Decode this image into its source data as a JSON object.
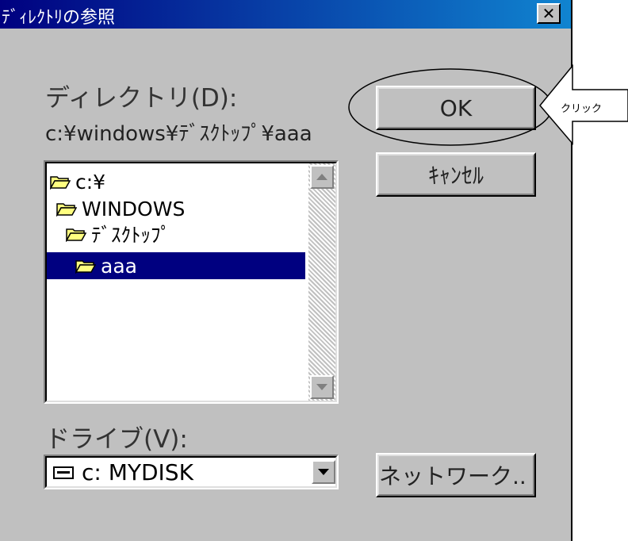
{
  "dialog": {
    "title": "ﾃﾞｨﾚｸﾄﾘの参照",
    "close_symbol": "✕"
  },
  "directory": {
    "label": "ディレクトリ(D):",
    "current_path": "c:¥windows¥ﾃﾞｽｸﾄｯﾌﾟ¥aaa",
    "tree": [
      {
        "label": "c:¥",
        "selected": false
      },
      {
        "label": "WINDOWS",
        "selected": false
      },
      {
        "label": "ﾃﾞｽｸﾄｯﾌﾟ",
        "selected": false
      },
      {
        "label": "aaa",
        "selected": true
      }
    ]
  },
  "drive": {
    "label": "ドライブ(V):",
    "selected": "c: MYDISK"
  },
  "buttons": {
    "ok": "OK",
    "cancel": "ｷｬﾝｾﾙ",
    "network": "ネットワーク.."
  },
  "annotation": {
    "callout_text": "クリック"
  },
  "colors": {
    "title_bar": "#000080",
    "selection": "#000080",
    "dialog_bg": "#c0c0c0"
  },
  "icons": [
    "close-icon",
    "folder-open-icon",
    "scroll-up-icon",
    "scroll-down-icon",
    "drive-icon",
    "dropdown-arrow-icon"
  ]
}
